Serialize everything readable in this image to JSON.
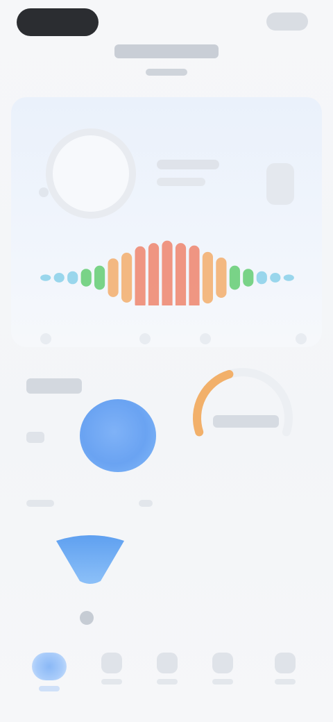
{
  "header": {
    "title": "",
    "subtitle": ""
  },
  "main_card": {
    "score_value": "",
    "score_label": ""
  },
  "equalizer": {
    "bars": [
      {
        "level": 0.08,
        "color": "#8fd3ea"
      },
      {
        "level": 0.12,
        "color": "#8fd3ea"
      },
      {
        "level": 0.16,
        "color": "#8fd3ea"
      },
      {
        "level": 0.22,
        "color": "#6ccf7a"
      },
      {
        "level": 0.3,
        "color": "#6ccf7a"
      },
      {
        "level": 0.48,
        "color": "#f3b173"
      },
      {
        "level": 0.62,
        "color": "#f3b173"
      },
      {
        "level": 0.78,
        "color": "#ee8b74"
      },
      {
        "level": 0.86,
        "color": "#ee8b74"
      },
      {
        "level": 0.92,
        "color": "#ee8b74"
      },
      {
        "level": 0.86,
        "color": "#ee8b74"
      },
      {
        "level": 0.8,
        "color": "#ee8b74"
      },
      {
        "level": 0.64,
        "color": "#f3b173"
      },
      {
        "level": 0.5,
        "color": "#f3b173"
      },
      {
        "level": 0.3,
        "color": "#6ccf7a"
      },
      {
        "level": 0.22,
        "color": "#6ccf7a"
      },
      {
        "level": 0.16,
        "color": "#8fd3ea"
      },
      {
        "level": 0.12,
        "color": "#8fd3ea"
      },
      {
        "level": 0.08,
        "color": "#8fd3ea"
      }
    ]
  },
  "section": {
    "title": ""
  },
  "gauge": {
    "value_text": "",
    "fraction": 0.42,
    "color": "#f2b06a"
  },
  "nav": {
    "items": [
      {
        "label": "",
        "icon": "home-icon"
      },
      {
        "label": "",
        "icon": "chart-icon"
      },
      {
        "label": "",
        "icon": "device-icon"
      },
      {
        "label": "",
        "icon": "bell-icon"
      },
      {
        "label": "",
        "icon": "profile-icon"
      }
    ]
  },
  "colors": {
    "accent": "#6aa3f2",
    "card_bg": "#eaf1fb"
  }
}
